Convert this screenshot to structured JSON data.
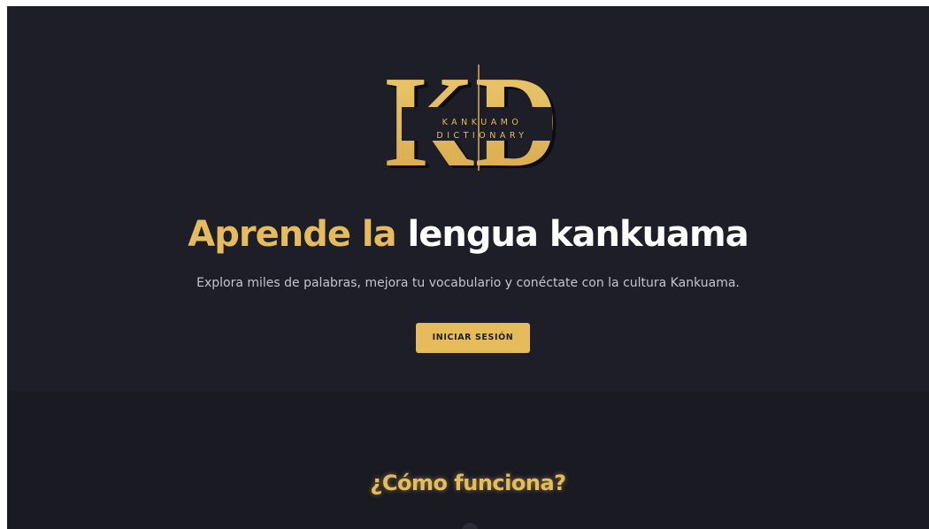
{
  "hero": {
    "logo": {
      "letters": "KD",
      "line1": "KANKUAMO",
      "line2": "DICTIONARY"
    },
    "title_accent": "Aprende la",
    "title_rest": "lengua kankuama",
    "subtitle": "Explora miles de palabras, mejora tu vocabulario y conéctate con la cultura Kankuama.",
    "login_label": "INICIAR SESIÓN"
  },
  "how_it_works": {
    "title": "¿Cómo funciona?"
  },
  "colors": {
    "accent": "#e5bb5c",
    "hero_background": "#1d1e27",
    "section_background": "#191a22",
    "heading_white": "#ffffff",
    "subtitle_text": "#c3c5ce"
  }
}
